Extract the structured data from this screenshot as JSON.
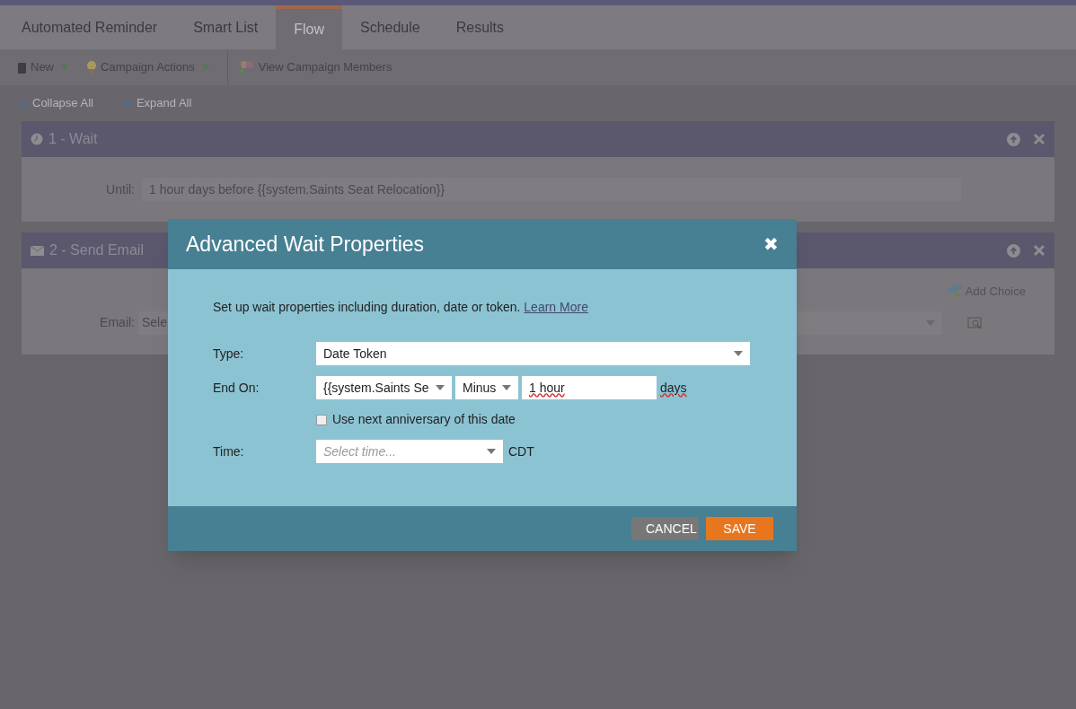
{
  "tabs": [
    {
      "label": "Automated Reminder",
      "selected": false
    },
    {
      "label": "Smart List",
      "selected": false
    },
    {
      "label": "Flow",
      "selected": true
    },
    {
      "label": "Schedule",
      "selected": false
    },
    {
      "label": "Results",
      "selected": false
    }
  ],
  "toolbar": [
    {
      "kind": "new",
      "label": "New",
      "menu": true
    },
    {
      "kind": "actions",
      "label": "Campaign Actions",
      "menu": true
    },
    {
      "kind": "members",
      "label": "View Campaign Members",
      "menu": false
    }
  ],
  "outline_controls": [
    {
      "kind": "collapse",
      "label": "Collapse All"
    },
    {
      "kind": "expand",
      "label": "Expand All"
    }
  ],
  "steps": [
    {
      "kind": "wait",
      "title": "1 - Wait",
      "field_label": "Until:",
      "field_value": "1 hour days before {{system.Saints Seat Relocation}}"
    },
    {
      "kind": "email",
      "title": "2 - Send Email",
      "field_label": "Email:",
      "field_value": "Sele",
      "add_choice": "Add Choice"
    }
  ],
  "dialog": {
    "title": "Advanced Wait Properties",
    "close": "✖",
    "intro": "Set up wait properties including duration, date or token.",
    "link": "Learn More",
    "type_label": "Type:",
    "type_value": "Date Token",
    "end_label": "End On:",
    "token_value": "{{system.Saints Se",
    "operator_value": "Minus",
    "offset_value": "1 hour",
    "unit": "days",
    "anniversary": {
      "label": "Use next anniversary of this date",
      "checked": false
    },
    "time_label": "Time:",
    "time_placeholder": "Select time...",
    "timezone": "CDT",
    "buttons": [
      {
        "kind": "cancel",
        "label": "CANCEL"
      },
      {
        "kind": "save",
        "label": "SAVE"
      }
    ]
  }
}
